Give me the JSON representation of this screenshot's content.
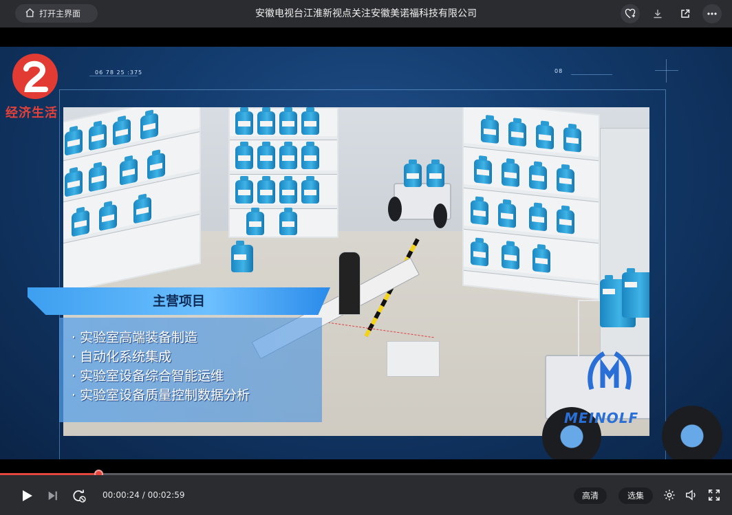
{
  "header": {
    "home_label": "打开主界面",
    "title": "安徽电视台江淮新视点关注安徽美诺福科技有限公司",
    "icons": [
      "add-to-favorites-icon",
      "download-icon",
      "open-external-icon",
      "more-icon"
    ]
  },
  "video": {
    "station_name": "经济生活",
    "hud_left": "06 78 25 :375",
    "hud_right": "08",
    "section_title": "主营项目",
    "items": [
      "· 实验室高端装备制造",
      "· 自动化系统集成",
      "· 实验室设备综合智能运维",
      "· 实验室设备质量控制数据分析"
    ],
    "brand": "MEINOLF"
  },
  "player": {
    "current_time": "00:00:24",
    "duration": "00:02:59",
    "time_display": "00:00:24 / 00:02:59",
    "progress_fraction": 0.134,
    "quality_label": "高清",
    "episodes_label": "选集",
    "accent_color": "#e3473e"
  }
}
